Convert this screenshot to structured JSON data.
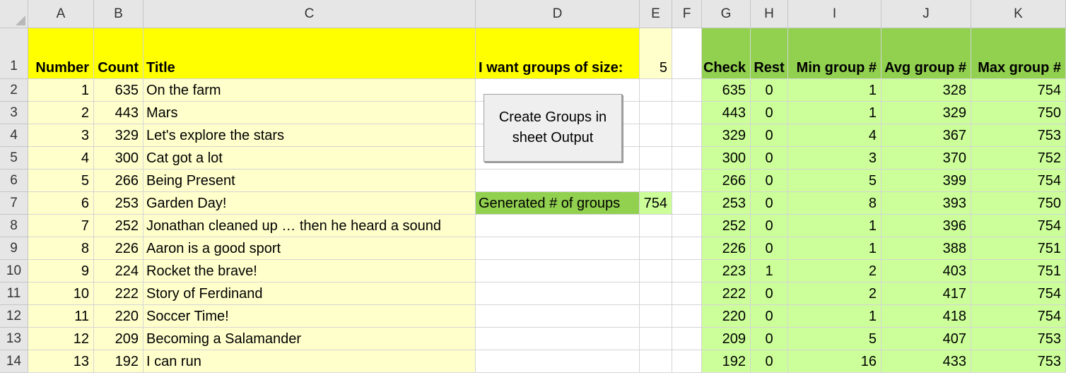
{
  "columns": [
    "A",
    "B",
    "C",
    "D",
    "E",
    "F",
    "G",
    "H",
    "I",
    "J",
    "K"
  ],
  "row_numbers": [
    "1",
    "2",
    "3",
    "4",
    "5",
    "6",
    "7",
    "8",
    "9",
    "10",
    "11",
    "12",
    "13",
    "14"
  ],
  "headers": {
    "number": "Number",
    "count": "Count",
    "title": "Title",
    "group_size_label": "I want groups of size:",
    "group_size_value": "5",
    "check": "Check",
    "rest": "Rest",
    "min_group": "Min group #",
    "avg_group": "Avg group #",
    "max_group": "Max group #"
  },
  "button": {
    "label": "Create Groups in sheet Output"
  },
  "generated": {
    "label": "Generated # of groups",
    "value": "754"
  },
  "rows": [
    {
      "number": "1",
      "count": "635",
      "title": "On the farm",
      "check": "635",
      "rest": "0",
      "min": "1",
      "avg": "328",
      "max": "754"
    },
    {
      "number": "2",
      "count": "443",
      "title": "Mars",
      "check": "443",
      "rest": "0",
      "min": "1",
      "avg": "329",
      "max": "750"
    },
    {
      "number": "3",
      "count": "329",
      "title": "Let's explore the stars",
      "check": "329",
      "rest": "0",
      "min": "4",
      "avg": "367",
      "max": "753"
    },
    {
      "number": "4",
      "count": "300",
      "title": "Cat got a lot",
      "check": "300",
      "rest": "0",
      "min": "3",
      "avg": "370",
      "max": "752"
    },
    {
      "number": "5",
      "count": "266",
      "title": "Being Present",
      "check": "266",
      "rest": "0",
      "min": "5",
      "avg": "399",
      "max": "754"
    },
    {
      "number": "6",
      "count": "253",
      "title": "Garden Day!",
      "check": "253",
      "rest": "0",
      "min": "8",
      "avg": "393",
      "max": "750"
    },
    {
      "number": "7",
      "count": "252",
      "title": "Jonathan cleaned up … then he heard a sound",
      "check": "252",
      "rest": "0",
      "min": "1",
      "avg": "396",
      "max": "754"
    },
    {
      "number": "8",
      "count": "226",
      "title": "Aaron is a good sport",
      "check": "226",
      "rest": "0",
      "min": "1",
      "avg": "388",
      "max": "751"
    },
    {
      "number": "9",
      "count": "224",
      "title": "Rocket the brave!",
      "check": "223",
      "rest": "1",
      "min": "2",
      "avg": "403",
      "max": "751"
    },
    {
      "number": "10",
      "count": "222",
      "title": "Story of Ferdinand",
      "check": "222",
      "rest": "0",
      "min": "2",
      "avg": "417",
      "max": "754"
    },
    {
      "number": "11",
      "count": "220",
      "title": "Soccer Time!",
      "check": "220",
      "rest": "0",
      "min": "1",
      "avg": "418",
      "max": "754"
    },
    {
      "number": "12",
      "count": "209",
      "title": "Becoming a Salamander",
      "check": "209",
      "rest": "0",
      "min": "5",
      "avg": "407",
      "max": "753"
    },
    {
      "number": "13",
      "count": "192",
      "title": "I can run",
      "check": "192",
      "rest": "0",
      "min": "16",
      "avg": "433",
      "max": "753"
    }
  ],
  "colors": {
    "yellow": "#ffff00",
    "light_yellow": "#ffffcc",
    "light_green": "#ccff99",
    "green": "#92d050",
    "header_gray": "#e6e6e6"
  }
}
